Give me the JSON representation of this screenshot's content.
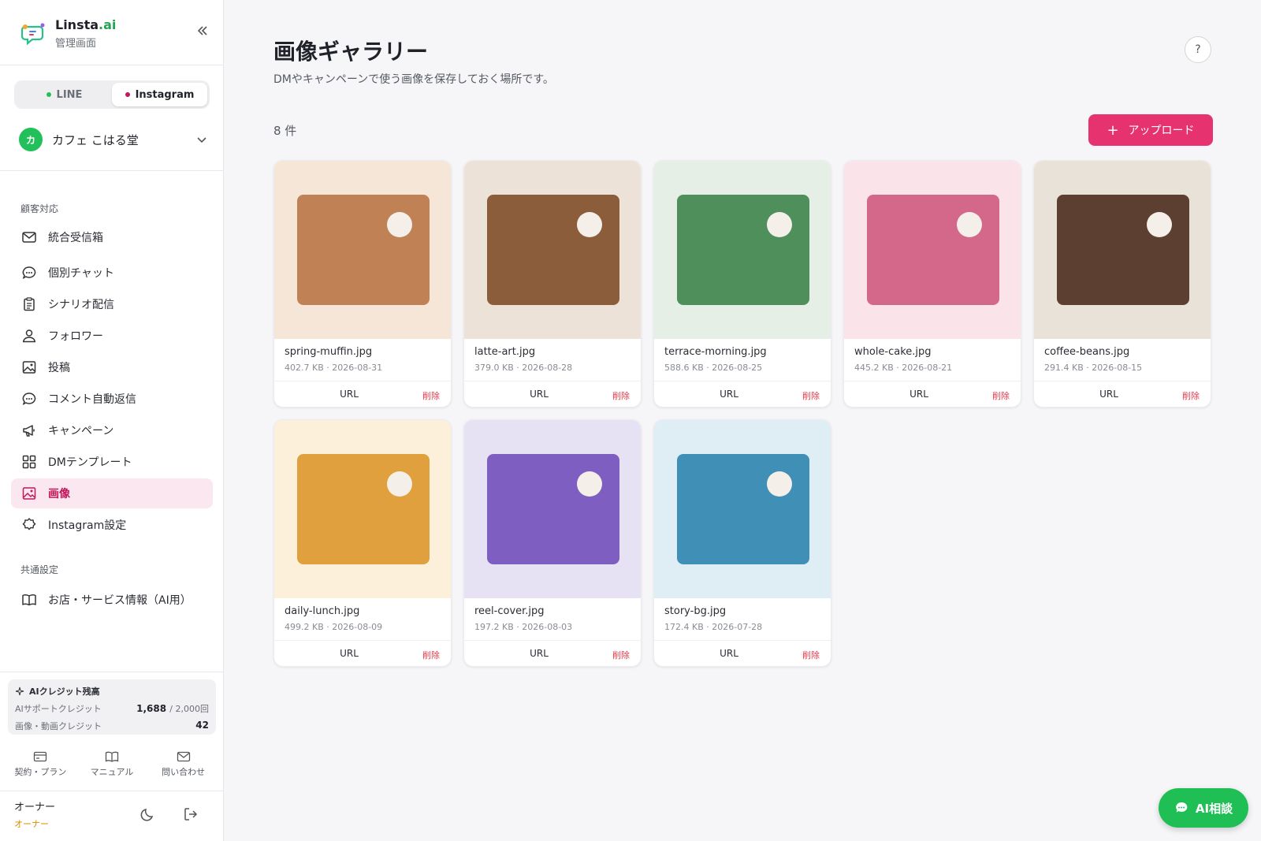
{
  "brand": {
    "name": "Linsta",
    "name_suffix": ".ai",
    "subtitle": "管理画面"
  },
  "channels": [
    {
      "label": "LINE",
      "color": "#22c05a",
      "active": false
    },
    {
      "label": "Instagram",
      "color": "#c2185b",
      "active": true
    }
  ],
  "account": {
    "avatar": "カ",
    "name": "カフェ こはる堂"
  },
  "nav": {
    "section_customer": "顧客対応",
    "items": [
      {
        "label": "統合受信箱",
        "icon": "mail-icon"
      },
      {
        "label": "個別チャット",
        "icon": "chat-bubble-icon"
      },
      {
        "label": "シナリオ配信",
        "icon": "clipboard-icon"
      },
      {
        "label": "フォロワー",
        "icon": "user-icon"
      },
      {
        "label": "投稿",
        "icon": "image-icon"
      },
      {
        "label": "コメント自動返信",
        "icon": "chat-bubble-icon"
      },
      {
        "label": "キャンペーン",
        "icon": "megaphone-icon"
      },
      {
        "label": "DMテンプレート",
        "icon": "grid-icon"
      },
      {
        "label": "画像",
        "icon": "image-icon",
        "active": true
      },
      {
        "label": "Instagram設定",
        "icon": "gear-icon"
      }
    ],
    "section_common": "共通設定",
    "common_items": [
      {
        "label": "お店・サービス情報（AI用）",
        "icon": "book-icon"
      }
    ]
  },
  "credits": {
    "title": "AIクレジット残高",
    "support_label": "AIサポートクレジット",
    "support_value": "1,688",
    "support_max": "/ 2,000回",
    "media_label": "画像・動画クレジット",
    "media_value": "42"
  },
  "footer_links": [
    {
      "label": "契約・プラン",
      "icon": "card-icon"
    },
    {
      "label": "マニュアル",
      "icon": "book-icon"
    },
    {
      "label": "問い合わせ",
      "icon": "mail-icon"
    }
  ],
  "user": {
    "name": "オーナー",
    "role": "オーナー"
  },
  "page": {
    "title": "画像ギャラリー",
    "description": "DMやキャンペーンで使う画像を保存しておく場所です。",
    "help": "?",
    "count": "8 件",
    "upload_label": "アップロード"
  },
  "gallery": {
    "url_label": "URL",
    "delete_label": "削除",
    "images": [
      {
        "name": "spring-muffin.jpg",
        "meta": "402.7 KB · 2026-08-31",
        "bg": "#f6e6d8",
        "fg": "#c08255"
      },
      {
        "name": "latte-art.jpg",
        "meta": "379.0 KB · 2026-08-28",
        "bg": "#ede2d8",
        "fg": "#8b5d3a"
      },
      {
        "name": "terrace-morning.jpg",
        "meta": "588.6 KB · 2026-08-25",
        "bg": "#e5efe6",
        "fg": "#4e8f5c"
      },
      {
        "name": "whole-cake.jpg",
        "meta": "445.2 KB · 2026-08-21",
        "bg": "#fbe3ea",
        "fg": "#d4688b"
      },
      {
        "name": "coffee-beans.jpg",
        "meta": "291.4 KB · 2026-08-15",
        "bg": "#e9e2d8",
        "fg": "#5c3f30"
      },
      {
        "name": "daily-lunch.jpg",
        "meta": "499.2 KB · 2026-08-09",
        "bg": "#fdf0db",
        "fg": "#e0a03e"
      },
      {
        "name": "reel-cover.jpg",
        "meta": "197.2 KB · 2026-08-03",
        "bg": "#e6e2f4",
        "fg": "#7e5ec0"
      },
      {
        "name": "story-bg.jpg",
        "meta": "172.4 KB · 2026-07-28",
        "bg": "#dfedf5",
        "fg": "#3f8fb7"
      }
    ]
  },
  "ai_chat": {
    "label": "AI相談"
  }
}
